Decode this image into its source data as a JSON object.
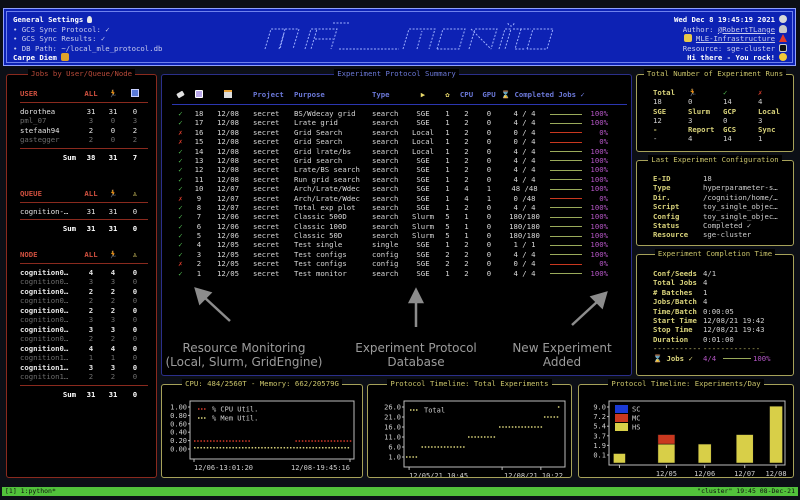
{
  "header": {
    "general_title": "General Settings",
    "gcs_protocol": "• GCS Sync Protocol: ✓",
    "gcs_results": "• GCS Sync Results: ✓",
    "db_path": "• DB Path: ~/local_mle_protocol.db",
    "motto": "Carpe Diem",
    "logo_text": "mle-monitor",
    "datetime": "Wed Dec 8 19:45:19 2021",
    "author_label": "Author: ",
    "author": "@RobertTLange",
    "repo": "MLE-Infrastructure",
    "resource": "Resource: sge-cluster",
    "greeting": "Hi there - You rock!"
  },
  "jobs_panel": {
    "title": "Jobs by User/Queue/Node",
    "user": {
      "headers": [
        "USER",
        "ALL",
        "running-icon",
        "paused-icon"
      ],
      "rows": [
        [
          "dorothea",
          "31",
          "31",
          "0"
        ],
        [
          "pml_07",
          "3",
          "0",
          "3"
        ],
        [
          "stefaah94",
          "2",
          "0",
          "2"
        ],
        [
          "gastegger",
          "2",
          "0",
          "2"
        ]
      ],
      "sum": [
        "Sum",
        "38",
        "31",
        "7"
      ]
    },
    "queue": {
      "headers": [
        "QUEUE",
        "ALL",
        "running-icon",
        "waiting-icon"
      ],
      "rows": [
        [
          "cognition-…",
          "31",
          "31",
          "0"
        ]
      ],
      "sum": [
        "Sum",
        "31",
        "31",
        "0"
      ]
    },
    "node": {
      "headers": [
        "NODE",
        "ALL",
        "running-icon",
        "waiting-icon"
      ],
      "rows": [
        [
          "cognition0…",
          "4",
          "4",
          "0"
        ],
        [
          "cognition0…",
          "3",
          "3",
          "0"
        ],
        [
          "cognition0…",
          "2",
          "2",
          "0"
        ],
        [
          "cognition0…",
          "2",
          "2",
          "0"
        ],
        [
          "cognition0…",
          "2",
          "2",
          "0"
        ],
        [
          "cognition0…",
          "3",
          "3",
          "0"
        ],
        [
          "cognition0…",
          "3",
          "3",
          "0"
        ],
        [
          "cognition0…",
          "2",
          "2",
          "0"
        ],
        [
          "cognition0…",
          "4",
          "4",
          "0"
        ],
        [
          "cognition1…",
          "1",
          "1",
          "0"
        ],
        [
          "cognition1…",
          "3",
          "3",
          "0"
        ],
        [
          "cognition1…",
          "2",
          "2",
          "0"
        ]
      ],
      "sum": [
        "Sum",
        "31",
        "31",
        "0"
      ]
    }
  },
  "protocol": {
    "title": "Experiment Protocol Summary",
    "headers": {
      "status": "tag-icon",
      "id": "id-icon",
      "date": "calendar-icon",
      "project": "Project",
      "purpose": "Purpose",
      "type": "Type",
      "resource": "▶",
      "seeds": "✿",
      "cpu": "CPU",
      "gpu": "GPU",
      "completed": "⌛ Completed Jobs ✓"
    },
    "rows": [
      {
        "ok": true,
        "id": "18",
        "date": "12/08",
        "project": "secret",
        "purpose": "BS/Wdecay grid",
        "type": "search",
        "resource": "SGE",
        "seeds": "1",
        "cpu": "2",
        "gpu": "0",
        "jobs": "4 / 4",
        "pct": 100
      },
      {
        "ok": true,
        "id": "17",
        "date": "12/08",
        "project": "secret",
        "purpose": "Lrate grid",
        "type": "search",
        "resource": "SGE",
        "seeds": "1",
        "cpu": "2",
        "gpu": "0",
        "jobs": "4 / 4",
        "pct": 100
      },
      {
        "ok": false,
        "id": "16",
        "date": "12/08",
        "project": "secret",
        "purpose": "Grid Search",
        "type": "search",
        "resource": "Local",
        "seeds": "1",
        "cpu": "2",
        "gpu": "0",
        "jobs": "0 / 4",
        "pct": 0
      },
      {
        "ok": false,
        "id": "15",
        "date": "12/08",
        "project": "secret",
        "purpose": "Grid Search",
        "type": "search",
        "resource": "Local",
        "seeds": "1",
        "cpu": "2",
        "gpu": "0",
        "jobs": "0 / 4",
        "pct": 0
      },
      {
        "ok": true,
        "id": "14",
        "date": "12/08",
        "project": "secret",
        "purpose": "Grid lrate/bs",
        "type": "search",
        "resource": "Local",
        "seeds": "1",
        "cpu": "2",
        "gpu": "0",
        "jobs": "4 / 4",
        "pct": 100
      },
      {
        "ok": true,
        "id": "13",
        "date": "12/08",
        "project": "secret",
        "purpose": "Grid search",
        "type": "search",
        "resource": "SGE",
        "seeds": "1",
        "cpu": "2",
        "gpu": "0",
        "jobs": "4 / 4",
        "pct": 100
      },
      {
        "ok": true,
        "id": "12",
        "date": "12/08",
        "project": "secret",
        "purpose": "Lrate/BS search",
        "type": "search",
        "resource": "SGE",
        "seeds": "1",
        "cpu": "2",
        "gpu": "0",
        "jobs": "4 / 4",
        "pct": 100
      },
      {
        "ok": true,
        "id": "11",
        "date": "12/08",
        "project": "secret",
        "purpose": "Run grid search",
        "type": "search",
        "resource": "SGE",
        "seeds": "1",
        "cpu": "2",
        "gpu": "0",
        "jobs": "4 / 4",
        "pct": 100
      },
      {
        "ok": true,
        "id": "10",
        "date": "12/07",
        "project": "secret",
        "purpose": "Arch/Lrate/Wdec",
        "type": "search",
        "resource": "SGE",
        "seeds": "1",
        "cpu": "4",
        "gpu": "1",
        "jobs": "48 /48",
        "pct": 100
      },
      {
        "ok": false,
        "id": "9",
        "date": "12/07",
        "project": "secret",
        "purpose": "Arch/Lrate/Wdec",
        "type": "search",
        "resource": "SGE",
        "seeds": "1",
        "cpu": "4",
        "gpu": "1",
        "jobs": "0 /48",
        "pct": 0
      },
      {
        "ok": true,
        "id": "8",
        "date": "12/07",
        "project": "secret",
        "purpose": "Total exp plot",
        "type": "search",
        "resource": "SGE",
        "seeds": "1",
        "cpu": "2",
        "gpu": "0",
        "jobs": "4 / 4",
        "pct": 100
      },
      {
        "ok": true,
        "id": "7",
        "date": "12/06",
        "project": "secret",
        "purpose": "Classic 500D",
        "type": "search",
        "resource": "Slurm",
        "seeds": "5",
        "cpu": "1",
        "gpu": "0",
        "jobs": "180/180",
        "pct": 100
      },
      {
        "ok": true,
        "id": "6",
        "date": "12/06",
        "project": "secret",
        "purpose": "Classic 100D",
        "type": "search",
        "resource": "Slurm",
        "seeds": "5",
        "cpu": "1",
        "gpu": "0",
        "jobs": "180/180",
        "pct": 100
      },
      {
        "ok": true,
        "id": "5",
        "date": "12/06",
        "project": "secret",
        "purpose": "Classic 50D",
        "type": "search",
        "resource": "Slurm",
        "seeds": "5",
        "cpu": "1",
        "gpu": "0",
        "jobs": "180/180",
        "pct": 100
      },
      {
        "ok": true,
        "id": "4",
        "date": "12/05",
        "project": "secret",
        "purpose": "Test single",
        "type": "single",
        "resource": "SGE",
        "seeds": "1",
        "cpu": "2",
        "gpu": "0",
        "jobs": "1 / 1",
        "pct": 100
      },
      {
        "ok": true,
        "id": "3",
        "date": "12/05",
        "project": "secret",
        "purpose": "Test configs",
        "type": "config",
        "resource": "SGE",
        "seeds": "2",
        "cpu": "2",
        "gpu": "0",
        "jobs": "4 / 4",
        "pct": 100
      },
      {
        "ok": false,
        "id": "2",
        "date": "12/05",
        "project": "secret",
        "purpose": "Test configs",
        "type": "config",
        "resource": "SGE",
        "seeds": "2",
        "cpu": "2",
        "gpu": "0",
        "jobs": "0 / 4",
        "pct": 0
      },
      {
        "ok": true,
        "id": "1",
        "date": "12/05",
        "project": "secret",
        "purpose": "Test monitor",
        "type": "search",
        "resource": "SGE",
        "seeds": "1",
        "cpu": "2",
        "gpu": "0",
        "jobs": "4 / 4",
        "pct": 100
      }
    ],
    "annotations": {
      "left": "Resource Monitoring\n(Local, Slurm, GridEngine)",
      "center": "Experiment Protocol\nDatabase",
      "right": "New Experiment\nAdded"
    }
  },
  "totals": {
    "title": "Total Number of Experiment Runs",
    "rows": [
      {
        "labels": [
          "Total",
          "running-icon",
          "✓",
          "✗"
        ],
        "values": [
          "18",
          "0",
          "14",
          "4"
        ]
      },
      {
        "labels": [
          "SGE",
          "Slurm",
          "GCP",
          "Local"
        ],
        "values": [
          "12",
          "3",
          "0",
          "3"
        ]
      },
      {
        "labels": [
          "-",
          "Report",
          "GCS",
          "Sync"
        ],
        "values": [
          "-",
          "4",
          "14",
          "1"
        ]
      }
    ]
  },
  "last_config": {
    "title": "Last Experiment Configuration",
    "rows": [
      [
        "E-ID",
        "18"
      ],
      [
        "Type",
        "hyperparameter-s…"
      ],
      [
        "Dir.",
        "/cognition/home/…"
      ],
      [
        "Script",
        "toy_single_objec…"
      ],
      [
        "Config",
        "toy_single_objec…"
      ],
      [
        "Status",
        "Completed ✓"
      ],
      [
        "Resource",
        "sge-cluster"
      ]
    ]
  },
  "completion": {
    "title": "Experiment Completion Time",
    "rows": [
      [
        "Conf/Seeds",
        "4/1"
      ],
      [
        "Total Jobs",
        "4"
      ],
      [
        "# Batches",
        "1"
      ],
      [
        "Jobs/Batch",
        "4"
      ],
      [
        "Time/Batch",
        "0:00:05"
      ],
      [
        "Start Time",
        "12/08/21 19:42"
      ],
      [
        "Stop Time",
        "12/08/21 19:43"
      ],
      [
        "Duration",
        "0:01:00"
      ]
    ],
    "jobs_label": "⌛ Jobs ✓",
    "jobs_value": "4/4",
    "jobs_pct": "100%",
    "progress": 1.0
  },
  "chart_data": [
    {
      "type": "line",
      "title": "CPU: 484/2560T - Memory: 662/20579G",
      "xlabel": "",
      "ylabel": "",
      "x_tick_labels": [
        "12/06-13:01:20",
        "12/08-19:45:16"
      ],
      "y_tick_labels": [
        "1.00",
        "0.80",
        "0.60",
        "0.40",
        "0.20",
        "0.00"
      ],
      "ylim": [
        0,
        1
      ],
      "legend": "top-left",
      "series": [
        {
          "name": "% CPU Util.",
          "color": "#d43a2a",
          "segments": [
            {
              "x": [
                0,
                0.35
              ],
              "y": 0.19
            },
            {
              "x": [
                0.65,
                1.0
              ],
              "y": 0.19
            }
          ]
        },
        {
          "name": "% Mem Util.",
          "color": "#d8d27a",
          "segments": [
            {
              "x": [
                0,
                1.0
              ],
              "y": 0.03
            }
          ]
        }
      ]
    },
    {
      "type": "line",
      "title": "Protocol Timeline: Total Experiments",
      "x_tick_labels": [
        "12/05/21 10:45",
        "12/08/21 10:22"
      ],
      "y_tick_labels": [
        "26.0",
        "21.0",
        "16.0",
        "11.0",
        "6.0",
        "1.0"
      ],
      "ylim": [
        1,
        26
      ],
      "legend": "top-left",
      "series": [
        {
          "name": "Total",
          "color": "#d8d27a",
          "steps": [
            {
              "x": [
                0.0,
                0.08
              ],
              "y": 1
            },
            {
              "x": [
                0.1,
                0.38
              ],
              "y": 6
            },
            {
              "x": [
                0.4,
                0.58
              ],
              "y": 11
            },
            {
              "x": [
                0.6,
                0.87
              ],
              "y": 16
            },
            {
              "x": [
                0.89,
                0.98
              ],
              "y": 21
            },
            {
              "x": [
                0.98,
                0.98
              ],
              "y": 26
            }
          ]
        }
      ]
    },
    {
      "type": "bar",
      "title": "Protocol Timeline: Experiments/Day",
      "categories": [
        "",
        "12/05",
        "12/06",
        "12/07",
        "12/08"
      ],
      "y_tick_labels": [
        "9.0",
        "7.2",
        "5.4",
        "3.7",
        "1.9",
        "0.1"
      ],
      "ylim": [
        0,
        9.5
      ],
      "legend": "top-left",
      "series": [
        {
          "name": "SC",
          "color": "#1a3ad6",
          "values": [
            0,
            0,
            0,
            0,
            0
          ]
        },
        {
          "name": "MC",
          "color": "#c9381f",
          "values": [
            0,
            1.5,
            0,
            0,
            0
          ]
        },
        {
          "name": "HS",
          "color": "#d8cf48",
          "values": [
            1.5,
            3,
            3,
            4.5,
            9
          ]
        }
      ]
    }
  ],
  "statusbar": {
    "left": "[1] 1:python*",
    "right": "\"cluster\" 19:45 08-Dec-21"
  }
}
